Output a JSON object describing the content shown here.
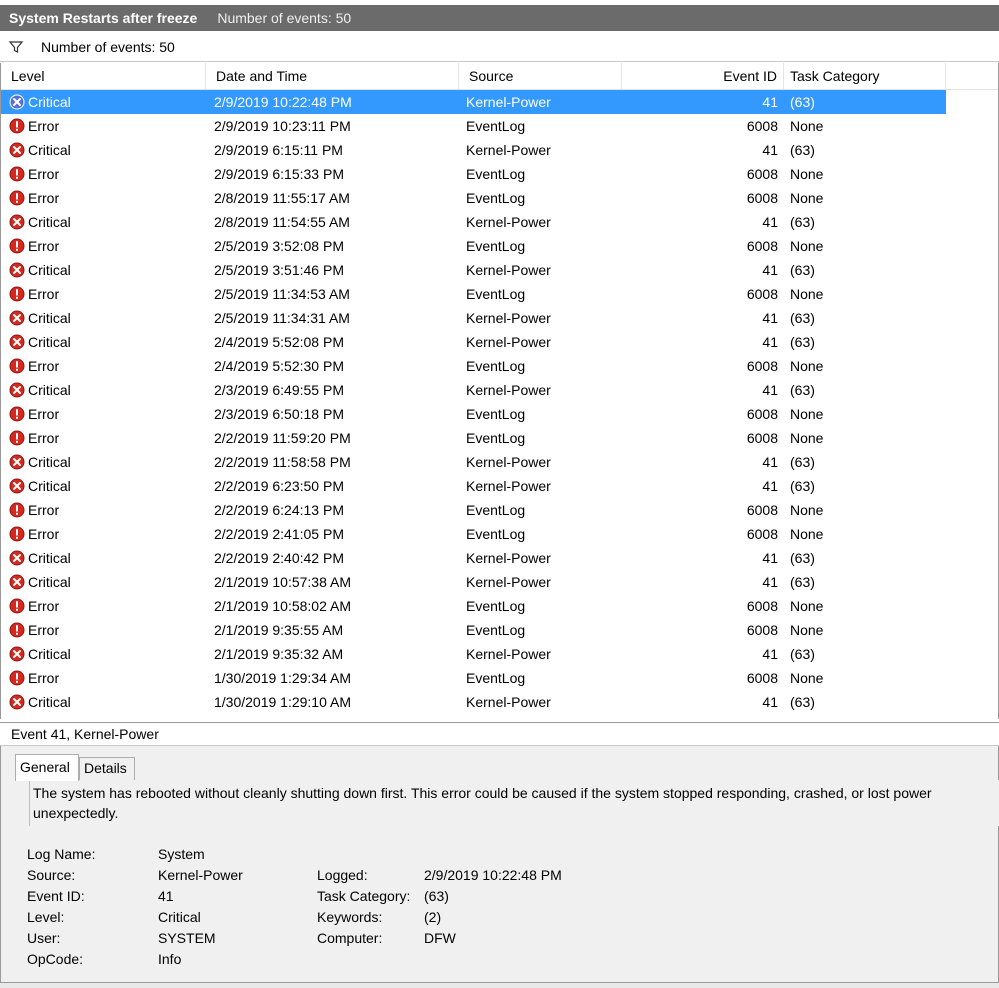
{
  "window": {
    "title": "System Restarts after freeze",
    "event_count": "Number of events: 50"
  },
  "filter_bar": {
    "count": "Number of events: 50"
  },
  "columns": {
    "level": "Level",
    "date": "Date and Time",
    "source": "Source",
    "event_id": "Event ID",
    "task": "Task Category"
  },
  "events": [
    {
      "level": "Critical",
      "date": "2/9/2019 10:22:48 PM",
      "source": "Kernel-Power",
      "id": "41",
      "task": "(63)"
    },
    {
      "level": "Error",
      "date": "2/9/2019 10:23:11 PM",
      "source": "EventLog",
      "id": "6008",
      "task": "None"
    },
    {
      "level": "Critical",
      "date": "2/9/2019 6:15:11 PM",
      "source": "Kernel-Power",
      "id": "41",
      "task": "(63)"
    },
    {
      "level": "Error",
      "date": "2/9/2019 6:15:33 PM",
      "source": "EventLog",
      "id": "6008",
      "task": "None"
    },
    {
      "level": "Error",
      "date": "2/8/2019 11:55:17 AM",
      "source": "EventLog",
      "id": "6008",
      "task": "None"
    },
    {
      "level": "Critical",
      "date": "2/8/2019 11:54:55 AM",
      "source": "Kernel-Power",
      "id": "41",
      "task": "(63)"
    },
    {
      "level": "Error",
      "date": "2/5/2019 3:52:08 PM",
      "source": "EventLog",
      "id": "6008",
      "task": "None"
    },
    {
      "level": "Critical",
      "date": "2/5/2019 3:51:46 PM",
      "source": "Kernel-Power",
      "id": "41",
      "task": "(63)"
    },
    {
      "level": "Error",
      "date": "2/5/2019 11:34:53 AM",
      "source": "EventLog",
      "id": "6008",
      "task": "None"
    },
    {
      "level": "Critical",
      "date": "2/5/2019 11:34:31 AM",
      "source": "Kernel-Power",
      "id": "41",
      "task": "(63)"
    },
    {
      "level": "Critical",
      "date": "2/4/2019 5:52:08 PM",
      "source": "Kernel-Power",
      "id": "41",
      "task": "(63)"
    },
    {
      "level": "Error",
      "date": "2/4/2019 5:52:30 PM",
      "source": "EventLog",
      "id": "6008",
      "task": "None"
    },
    {
      "level": "Critical",
      "date": "2/3/2019 6:49:55 PM",
      "source": "Kernel-Power",
      "id": "41",
      "task": "(63)"
    },
    {
      "level": "Error",
      "date": "2/3/2019 6:50:18 PM",
      "source": "EventLog",
      "id": "6008",
      "task": "None"
    },
    {
      "level": "Error",
      "date": "2/2/2019 11:59:20 PM",
      "source": "EventLog",
      "id": "6008",
      "task": "None"
    },
    {
      "level": "Critical",
      "date": "2/2/2019 11:58:58 PM",
      "source": "Kernel-Power",
      "id": "41",
      "task": "(63)"
    },
    {
      "level": "Critical",
      "date": "2/2/2019 6:23:50 PM",
      "source": "Kernel-Power",
      "id": "41",
      "task": "(63)"
    },
    {
      "level": "Error",
      "date": "2/2/2019 6:24:13 PM",
      "source": "EventLog",
      "id": "6008",
      "task": "None"
    },
    {
      "level": "Error",
      "date": "2/2/2019 2:41:05 PM",
      "source": "EventLog",
      "id": "6008",
      "task": "None"
    },
    {
      "level": "Critical",
      "date": "2/2/2019 2:40:42 PM",
      "source": "Kernel-Power",
      "id": "41",
      "task": "(63)"
    },
    {
      "level": "Critical",
      "date": "2/1/2019 10:57:38 AM",
      "source": "Kernel-Power",
      "id": "41",
      "task": "(63)"
    },
    {
      "level": "Error",
      "date": "2/1/2019 10:58:02 AM",
      "source": "EventLog",
      "id": "6008",
      "task": "None"
    },
    {
      "level": "Error",
      "date": "2/1/2019 9:35:55 AM",
      "source": "EventLog",
      "id": "6008",
      "task": "None"
    },
    {
      "level": "Critical",
      "date": "2/1/2019 9:35:32 AM",
      "source": "Kernel-Power",
      "id": "41",
      "task": "(63)"
    },
    {
      "level": "Error",
      "date": "1/30/2019 1:29:34 AM",
      "source": "EventLog",
      "id": "6008",
      "task": "None"
    },
    {
      "level": "Critical",
      "date": "1/30/2019 1:29:10 AM",
      "source": "Kernel-Power",
      "id": "41",
      "task": "(63)"
    }
  ],
  "selected_index": 0,
  "detail": {
    "header": "Event 41, Kernel-Power",
    "tabs": {
      "general": "General",
      "details": "Details"
    },
    "description": "The system has rebooted without cleanly shutting down first. This error could be caused if the system stopped responding, crashed, or lost power unexpectedly.",
    "left": [
      {
        "label": "Log Name:",
        "value": "System"
      },
      {
        "label": "Source:",
        "value": "Kernel-Power"
      },
      {
        "label": "Event ID:",
        "value": "41"
      },
      {
        "label": "Level:",
        "value": "Critical"
      },
      {
        "label": "User:",
        "value": "SYSTEM"
      },
      {
        "label": "OpCode:",
        "value": "Info"
      }
    ],
    "right": [
      {
        "label": "Logged:",
        "value": "2/9/2019 10:22:48 PM"
      },
      {
        "label": "Task Category:",
        "value": "(63)"
      },
      {
        "label": "Keywords:",
        "value": "(2)"
      },
      {
        "label": "Computer:",
        "value": "DFW"
      }
    ]
  },
  "colors": {
    "selection": "#3399ff",
    "titlebar": "#6b6b6b",
    "error_red": "#d6281f"
  },
  "icons": {
    "critical": "critical-x-icon",
    "error": "error-exclamation-icon",
    "filter": "funnel-icon"
  }
}
